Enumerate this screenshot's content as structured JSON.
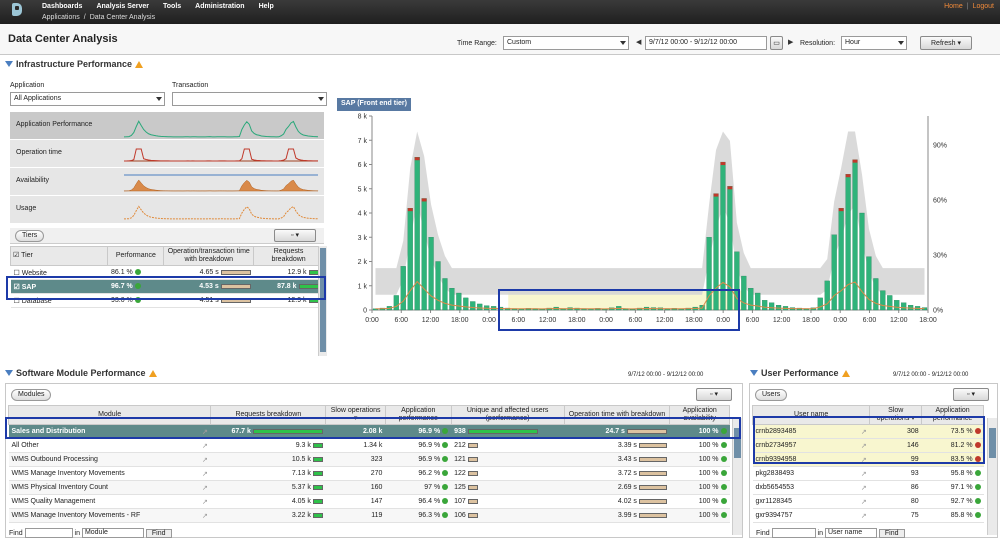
{
  "topbar": {
    "menu": [
      "Dashboards",
      "Analysis Server",
      "Tools",
      "Administration",
      "Help"
    ],
    "breadcrumb": [
      "Applications",
      "/",
      "Data Center Analysis"
    ],
    "links": [
      "Home",
      "|",
      "Logout"
    ]
  },
  "header": {
    "title": "Data Center Analysis",
    "time_range_label": "Time Range:",
    "time_range_value": "Custom",
    "date_range": "9/7/12 00:00 - 9/12/12 00:00",
    "resolution_label": "Resolution:",
    "resolution_value": "Hour",
    "refresh_label": "Refresh"
  },
  "infra": {
    "title": "Infrastructure Performance",
    "application_label": "Application",
    "application_value": "All Applications",
    "transaction_label": "Transaction",
    "transaction_value": "",
    "metrics": [
      "Application Performance",
      "Operation time",
      "Availability",
      "Usage"
    ],
    "tiers_tab": "Tiers",
    "columns": [
      "Tier",
      "Performance",
      "Operation/transaction time with breakdown",
      "Requests breakdown"
    ],
    "rows": [
      {
        "name": "Website",
        "perf": "86.1 %",
        "op": "4.65 s",
        "req": "12.9 k"
      },
      {
        "name": "SAP",
        "perf": "96.7 %",
        "op": "4.53 s",
        "req": "87.8 k"
      },
      {
        "name": "Database",
        "perf": "93.0 %",
        "op": "4.51 s",
        "req": "12.9 k"
      }
    ]
  },
  "chart_data": {
    "type": "bar",
    "title": "SAP (Front end tier)",
    "yticks_left": [
      "8 k",
      "7 k",
      "6 k",
      "5 k",
      "4 k",
      "3 k",
      "2 k",
      "1 k",
      "0"
    ],
    "yticks_right": [
      "90%",
      "60%",
      "30%",
      "0%"
    ],
    "xticks": [
      "0:00",
      "6:00",
      "12:00",
      "18:00",
      "0:00",
      "6:00",
      "12:00",
      "18:00",
      "0:00",
      "6:00",
      "12:00",
      "18:00",
      "0:00",
      "6:00",
      "12:00",
      "18:00",
      "0:00",
      "6:00",
      "12:00",
      "18:00"
    ],
    "ylim": [
      0,
      8000
    ],
    "series": [
      {
        "values": [
          50,
          80,
          150,
          600,
          1800,
          4200,
          6300,
          4600,
          3000,
          2000,
          1300,
          900,
          700,
          500,
          350,
          250,
          180,
          150,
          120,
          80,
          60,
          50,
          70,
          60,
          40,
          80,
          120,
          60,
          100,
          80,
          60,
          50,
          70,
          40,
          90,
          150,
          60,
          40,
          80,
          120,
          100,
          90,
          60,
          70,
          50,
          80,
          120,
          200,
          3000,
          4800,
          6100,
          5100,
          2400,
          1400,
          900,
          700,
          400,
          300,
          200,
          150,
          100,
          80,
          60,
          90,
          500,
          1200,
          3100,
          4200,
          5600,
          6200,
          4000,
          2200,
          1300,
          800,
          600,
          400,
          300,
          200,
          150,
          100
        ]
      }
    ]
  },
  "software": {
    "title": "Software Module Performance",
    "date_range": "9/7/12 00:00 - 9/12/12 00:00",
    "modules_tab": "Modules",
    "columns": [
      "Module",
      "Requests breakdown",
      "Slow operations",
      "Application performance",
      "Unique and affected users (performance)",
      "Operation time with breakdown",
      "Application availability"
    ],
    "rows": [
      {
        "name": "Sales and Distribution",
        "req": "67.7 k",
        "slow": "2.08 k",
        "perf": "96.9 %",
        "users": "938",
        "op": "24.7 s",
        "avail": "100 %"
      },
      {
        "name": "All Other",
        "req": "9.3 k",
        "slow": "1.34 k",
        "perf": "96.9 %",
        "users": "212",
        "op": "3.39 s",
        "avail": "100 %"
      },
      {
        "name": "WMS Outbound Processing",
        "req": "10.5 k",
        "slow": "323",
        "perf": "96.9 %",
        "users": "121",
        "op": "3.43 s",
        "avail": "100 %"
      },
      {
        "name": "WMS Manage Inventory Movements",
        "req": "7.13 k",
        "slow": "270",
        "perf": "96.2 %",
        "users": "122",
        "op": "3.72 s",
        "avail": "100 %"
      },
      {
        "name": "WMS Physical Inventory Count",
        "req": "5.37 k",
        "slow": "160",
        "perf": "97 %",
        "users": "125",
        "op": "2.69 s",
        "avail": "100 %"
      },
      {
        "name": "WMS Quality Management",
        "req": "4.05 k",
        "slow": "147",
        "perf": "96.4 %",
        "users": "107",
        "op": "4.02 s",
        "avail": "100 %"
      },
      {
        "name": "WMS Manage Inventory Movements - RF",
        "req": "3.22 k",
        "slow": "119",
        "perf": "96.3 %",
        "users": "106",
        "op": "3.99 s",
        "avail": "100 %"
      }
    ],
    "find_label": "Find",
    "in_label": "in",
    "in_value": "Module",
    "find_button": "Find"
  },
  "users": {
    "title": "User Performance",
    "date_range": "9/7/12 00:00 - 9/12/12 00:00",
    "users_tab": "Users",
    "columns": [
      "User name",
      "Slow operations",
      "Application performance"
    ],
    "rows": [
      {
        "name": "crnb2893485",
        "slow": "308",
        "perf": "73.5 %"
      },
      {
        "name": "crnb2734957",
        "slow": "146",
        "perf": "81.2 %"
      },
      {
        "name": "crnb9394958",
        "slow": "99",
        "perf": "83.5 %"
      },
      {
        "name": "pkg2838493",
        "slow": "93",
        "perf": "95.8 %"
      },
      {
        "name": "dxb5654553",
        "slow": "86",
        "perf": "97.1 %"
      },
      {
        "name": "gxr1128345",
        "slow": "80",
        "perf": "92.7 %"
      },
      {
        "name": "gxr9394757",
        "slow": "75",
        "perf": "85.8 %"
      }
    ],
    "find_label": "Find",
    "in_label": "in",
    "in_value": "User name",
    "find_button": "Find"
  }
}
